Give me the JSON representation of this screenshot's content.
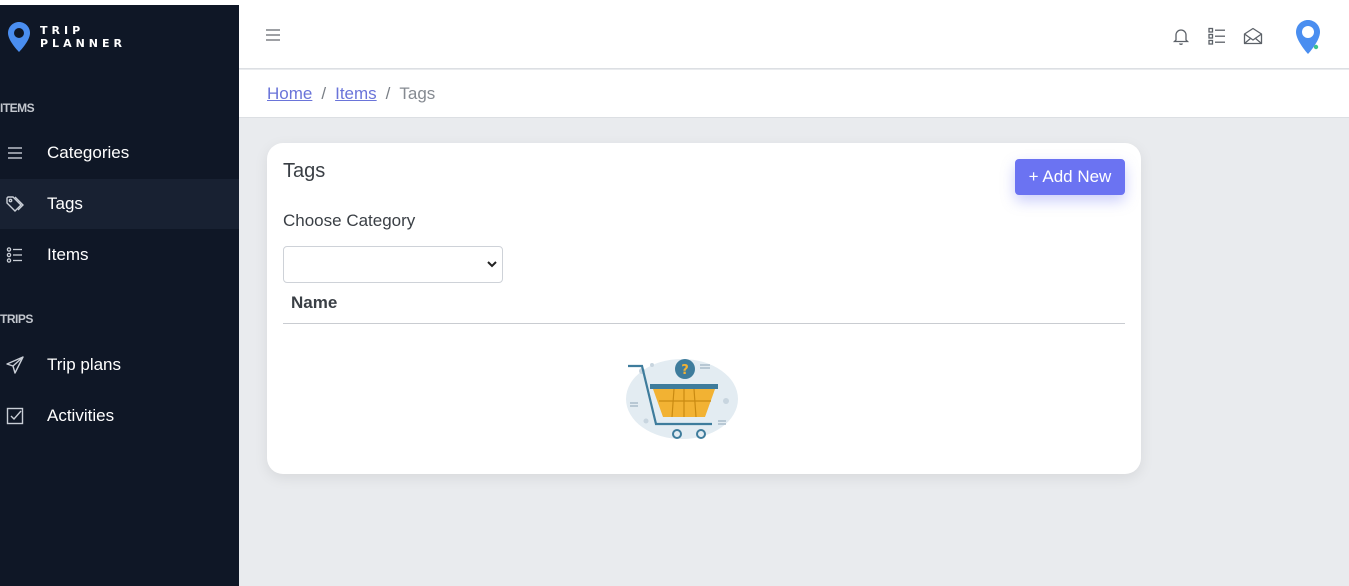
{
  "brand": {
    "line1": "TRIP",
    "line2": "PLANNER"
  },
  "sidebar": {
    "sections": [
      {
        "label": "ITEMS"
      },
      {
        "label": "TRIPS"
      }
    ],
    "items": [
      {
        "label": "Categories",
        "icon": "list-icon"
      },
      {
        "label": "Tags",
        "icon": "tags-icon",
        "active": true
      },
      {
        "label": "Items",
        "icon": "checklist-icon"
      },
      {
        "label": "Trip plans",
        "icon": "paper-plane-icon"
      },
      {
        "label": "Activities",
        "icon": "checkbox-icon"
      }
    ]
  },
  "header": {
    "icons": [
      "menu-icon",
      "bell-icon",
      "task-list-icon",
      "mail-icon",
      "location-pin-avatar"
    ]
  },
  "breadcrumb": {
    "home": "Home",
    "items": "Items",
    "separator": "/",
    "current": "Tags"
  },
  "card": {
    "title": "Tags",
    "add_button": "+ Add New",
    "choose_label": "Choose Category",
    "select_value": "",
    "table_header": "Name",
    "empty_state_icon": "empty-cart-illustration"
  },
  "colors": {
    "sidebar_bg": "#0f1726",
    "accent": "#6b73f2",
    "link": "#6a74d9",
    "pin_blue": "#4a8ef0"
  }
}
